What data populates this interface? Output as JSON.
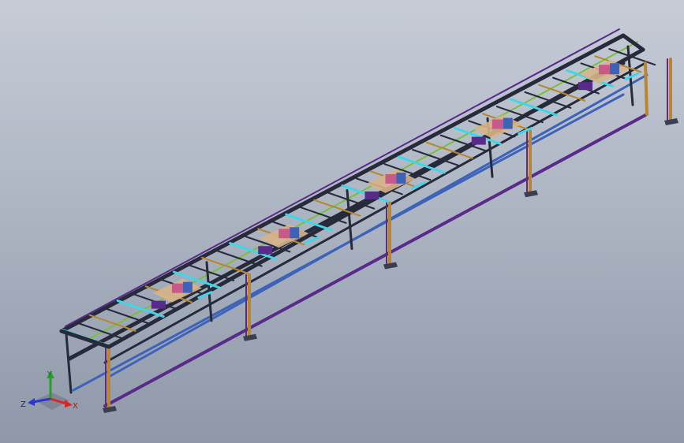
{
  "viewport": {
    "background_top": "#c7ccd6",
    "background_bottom": "#8e98a8"
  },
  "model": {
    "sections": 5,
    "colors": {
      "frame_dark": "#262a3a",
      "frame_purple": "#5a2a8a",
      "rail_blue": "#3d63b8",
      "beam_orange": "#b8862e",
      "accent_cyan": "#3fd6e8",
      "accent_green": "#7abf3a",
      "motor_pink": "#c85a8a",
      "plate_tan": "#d8b48a"
    }
  },
  "triad": {
    "x_label": "X",
    "y_label": "Y",
    "z_label": "Z",
    "x_color": "#d62828",
    "y_color": "#28a028",
    "z_color": "#2838d6"
  }
}
